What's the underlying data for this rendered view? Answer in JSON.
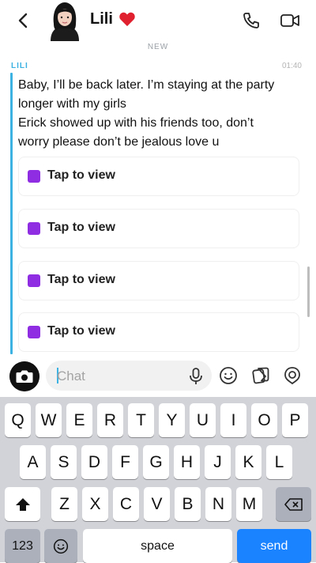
{
  "header": {
    "contact_name": "Lili",
    "back_icon": "chevron-left-icon",
    "call_icon": "phone-icon",
    "video_icon": "video-camera-icon"
  },
  "chat": {
    "new_label": "NEW",
    "sender": "LILI",
    "time": "01:40",
    "accent_color": "#3cb2e2",
    "message_lines": [
      "Baby, I’ll be back later. I’m staying at the party",
      "longer with my girls",
      "Erick showed up with his friends too, don’t",
      "worry please don’t be jealous love u"
    ],
    "snaps": [
      {
        "label": "Tap to view",
        "color": "#8e2de2"
      },
      {
        "label": "Tap to view",
        "color": "#8e2de2"
      },
      {
        "label": "Tap to view",
        "color": "#8e2de2"
      },
      {
        "label": "Tap to view",
        "color": "#8e2de2"
      }
    ]
  },
  "input": {
    "placeholder": "Chat",
    "camera_icon": "camera-icon",
    "mic_icon": "microphone-icon",
    "emoji_icon": "emoji-icon",
    "sticker_icon": "sticker-icon",
    "lens_icon": "lens-icon"
  },
  "keyboard": {
    "row1": [
      "Q",
      "W",
      "E",
      "R",
      "T",
      "Y",
      "U",
      "I",
      "O",
      "P"
    ],
    "row2": [
      "A",
      "S",
      "D",
      "F",
      "G",
      "H",
      "J",
      "K",
      "L"
    ],
    "row3": [
      "Z",
      "X",
      "C",
      "V",
      "B",
      "N",
      "M"
    ],
    "numbers_label": "123",
    "space_label": "space",
    "send_label": "send",
    "send_color": "#1a83ff"
  }
}
